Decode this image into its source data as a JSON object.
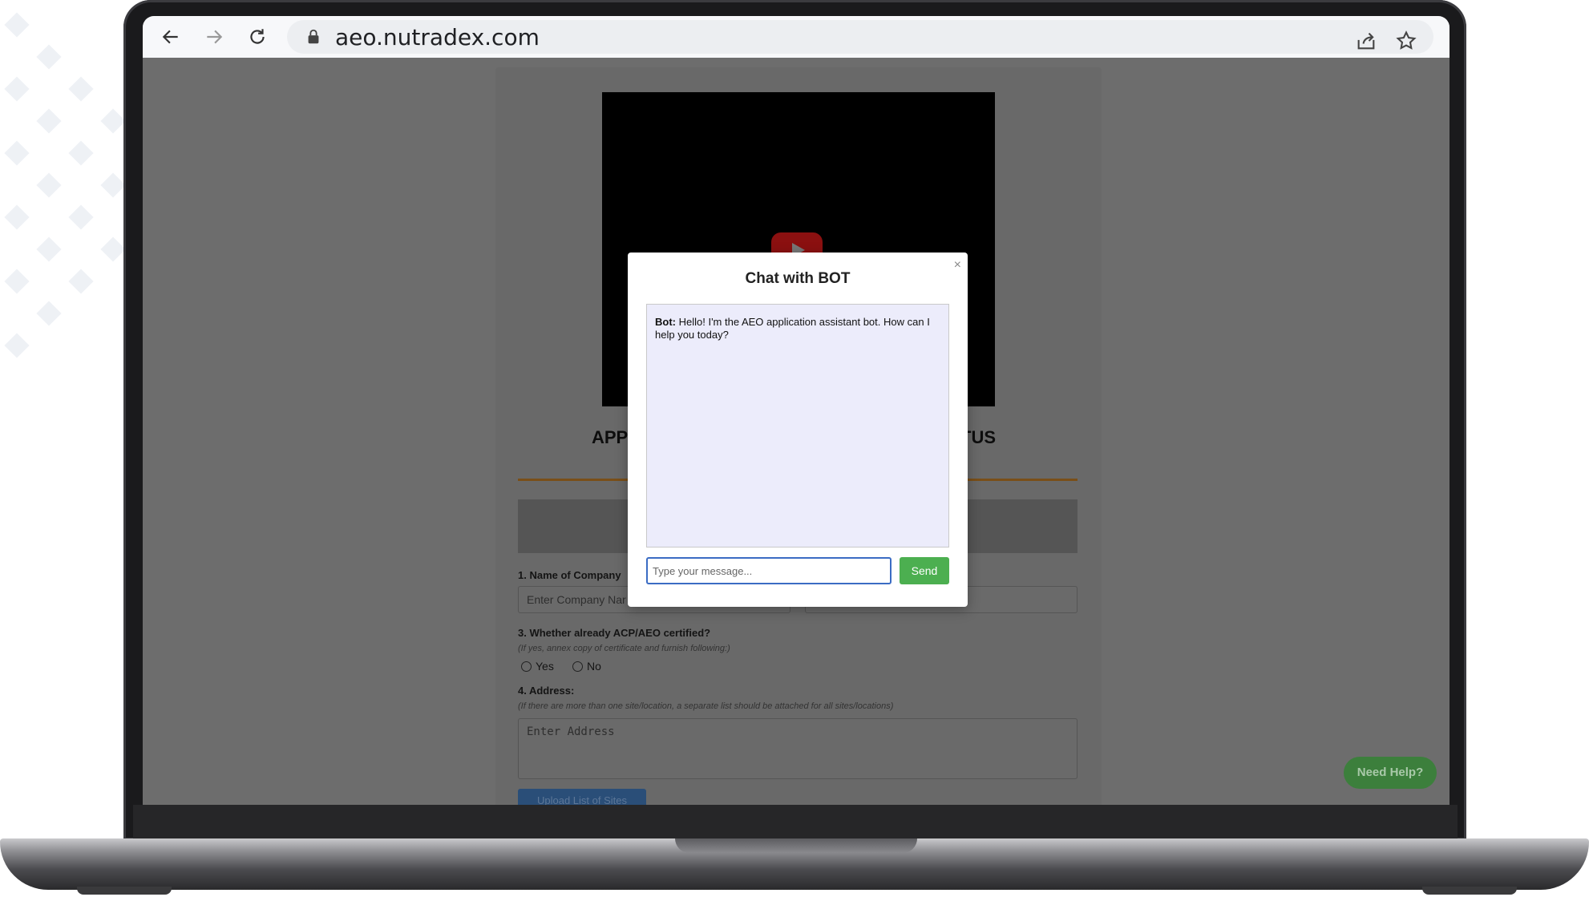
{
  "browser": {
    "url": "aeo.nutradex.com"
  },
  "page": {
    "heading_left": "APP",
    "heading_right": "TUS",
    "q1_label": "1. Name of Company",
    "q1_placeholder": "Enter Company Nar",
    "q3_label": "3. Whether already ACP/AEO certified?",
    "q3_note": "(If yes, annex copy of certificate and furnish following:)",
    "q3_options": [
      "Yes",
      "No"
    ],
    "q4_label": "4. Address:",
    "q4_note": "(If there are more than one site/location, a separate list should be attached for all sites/locations)",
    "address_placeholder": "Enter Address",
    "upload_label": "Upload List of Sites",
    "help_label": "Need Help?"
  },
  "chat": {
    "title": "Chat with BOT",
    "close_glyph": "×",
    "messages": [
      {
        "sender": "Bot:",
        "text": "Hello! I'm the AEO application assistant bot. How can I help you today?"
      }
    ],
    "input_placeholder": "Type your message...",
    "send_label": "Send"
  },
  "colors": {
    "send": "#4caf50",
    "help": "#3c7f3c",
    "chat_bg": "#ececfb",
    "input_focus": "#3b6cc4"
  }
}
